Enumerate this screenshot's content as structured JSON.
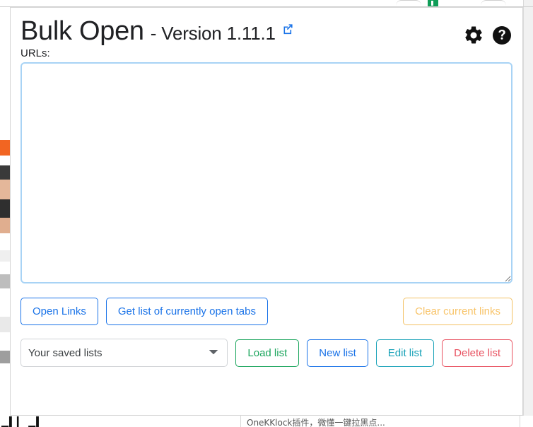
{
  "background": {
    "bottom_text": "OneKKlock插件，微懂一键拉黑点...",
    "bottom_bars": "▁▍▎  ▁▍"
  },
  "popup": {
    "title": "Bulk Open",
    "version": "- Version 1.11.1",
    "external_link_icon": "external-link-icon",
    "gear_icon": "gear-icon",
    "help_icon": "help-circle-icon",
    "urls_label": "URLs:",
    "urls_value": "",
    "urls_placeholder": "",
    "actions": {
      "open_links": "Open Links",
      "get_tabs": "Get list of currently open tabs",
      "clear_links": "Clear current links"
    },
    "lists": {
      "select_value": "Your saved lists",
      "options": [
        "Your saved lists"
      ],
      "load": "Load list",
      "new": "New list",
      "edit": "Edit list",
      "delete": "Delete list"
    },
    "colors": {
      "blue": "#1a73e8",
      "amber": "#f8c46a",
      "green": "#1aa55c",
      "teal": "#19a2b8",
      "red": "#e8505f",
      "textarea_border": "#a8d3f5",
      "badge_green": "#0f9d58"
    }
  }
}
